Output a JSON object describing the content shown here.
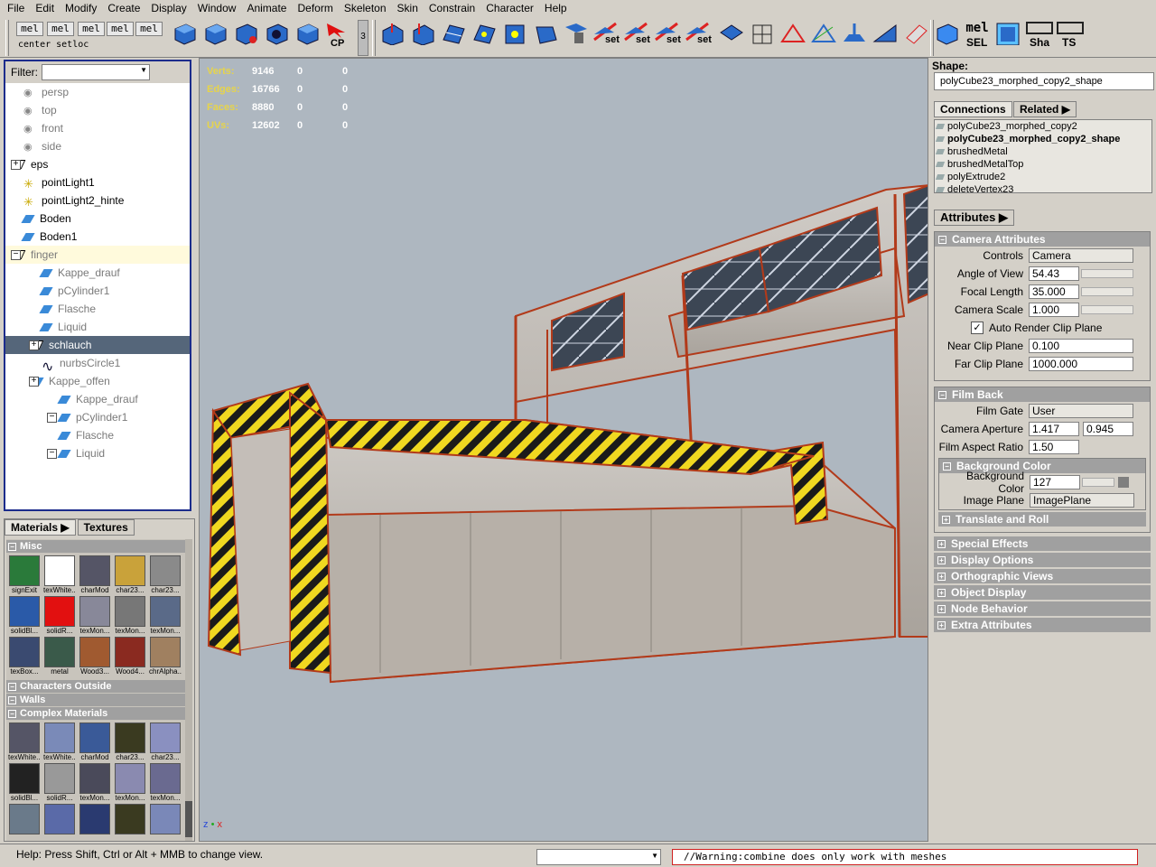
{
  "menubar": [
    "File",
    "Edit",
    "Modify",
    "Create",
    "Display",
    "Window",
    "Animate",
    "Deform",
    "Skeleton",
    "Skin",
    "Constrain",
    "Character",
    "Help"
  ],
  "toolbar": {
    "mel_labels": [
      "mel",
      "mel",
      "mel",
      "mel",
      "mel"
    ],
    "mel_caption": "center setloc",
    "cp_label": "CP",
    "shelf_num": "3",
    "set_labels": [
      "set",
      "set",
      "set",
      "set"
    ],
    "mel_right": "mel",
    "sel_label": "SEL",
    "sha_label": "Sha",
    "ts_label": "TS"
  },
  "outliner": {
    "filter_label": "Filter:",
    "filter_value": "",
    "items": [
      {
        "label": "persp",
        "grey": true,
        "icon": "camera-icon"
      },
      {
        "label": "top",
        "grey": true,
        "icon": "camera-icon"
      },
      {
        "label": "front",
        "grey": true,
        "icon": "camera-icon"
      },
      {
        "label": "side",
        "grey": true,
        "icon": "camera-icon"
      },
      {
        "label": "eps",
        "grey": false,
        "icon": "transform-icon"
      },
      {
        "label": "pointLight1",
        "grey": false,
        "icon": "light-icon"
      },
      {
        "label": "pointLight2_hinte",
        "grey": false,
        "icon": "light-icon"
      },
      {
        "label": "Boden",
        "grey": false,
        "icon": "mesh-icon"
      },
      {
        "label": "Boden1",
        "grey": false,
        "icon": "mesh-icon"
      },
      {
        "label": "finger",
        "grey": true,
        "icon": "transform-icon"
      },
      {
        "label": "Kappe_drauf",
        "grey": true,
        "icon": "mesh-icon"
      },
      {
        "label": "pCylinder1",
        "grey": true,
        "icon": "mesh-icon"
      },
      {
        "label": "Flasche",
        "grey": true,
        "icon": "mesh-icon"
      },
      {
        "label": "Liquid",
        "grey": true,
        "icon": "mesh-icon"
      },
      {
        "label": "schlauch",
        "grey": false,
        "icon": "transform-icon"
      },
      {
        "label": "nurbsCircle1",
        "grey": true,
        "icon": "curve-icon"
      },
      {
        "label": "Kappe_offen",
        "grey": true,
        "icon": "mesh-icon"
      },
      {
        "label": "Kappe_drauf",
        "grey": true,
        "icon": "mesh-icon"
      },
      {
        "label": "pCylinder1",
        "grey": true,
        "icon": "mesh-icon"
      },
      {
        "label": "Flasche",
        "grey": true,
        "icon": "mesh-icon"
      },
      {
        "label": "Liquid",
        "grey": true,
        "icon": "mesh-icon"
      }
    ]
  },
  "hud": [
    {
      "k": "Verts:",
      "v": "9146",
      "a": "0",
      "b": "0"
    },
    {
      "k": "Edges:",
      "v": "16766",
      "a": "0",
      "b": "0"
    },
    {
      "k": "Faces:",
      "v": "8880",
      "a": "0",
      "b": "0"
    },
    {
      "k": "UVs:",
      "v": "12602",
      "a": "0",
      "b": "0"
    }
  ],
  "axis": {
    "z": "z",
    "x": "x"
  },
  "hypershade": {
    "tab_materials": "Materials",
    "tab_textures": "Textures",
    "sections": {
      "misc": "Misc",
      "chars": "Characters Outside",
      "walls": "Walls",
      "complex": "Complex Materials"
    },
    "misc_swatches": [
      {
        "label": "signExit",
        "color": "#2a7a3a"
      },
      {
        "label": "texWhite...",
        "color": "#ffffff"
      },
      {
        "label": "charMod",
        "color": "#556"
      },
      {
        "label": "char23...",
        "color": "#c9a23a"
      },
      {
        "label": "char23...",
        "color": "#8a8a8a"
      },
      {
        "label": "solidBl...",
        "color": "#2a5aa8"
      },
      {
        "label": "solidR...",
        "color": "#e21010"
      },
      {
        "label": "texMon...",
        "color": "#889"
      },
      {
        "label": "texMon...",
        "color": "#777"
      },
      {
        "label": "texMon...",
        "color": "#5a6a88"
      },
      {
        "label": "texBox...",
        "color": "#3a4a70"
      },
      {
        "label": "metal",
        "color": "#3a5a4a"
      },
      {
        "label": "Wood3...",
        "color": "#a05a30"
      },
      {
        "label": "Wood4...",
        "color": "#8a2a20"
      },
      {
        "label": "chrAlpha...",
        "color": "#a08060"
      }
    ],
    "complex_swatches": [
      {
        "label": "texWhite...",
        "color": "#556"
      },
      {
        "label": "texWhite...",
        "color": "#7a8ab8"
      },
      {
        "label": "charMod",
        "color": "#3a5a98"
      },
      {
        "label": "char23...",
        "color": "#3a3a20"
      },
      {
        "label": "char23...",
        "color": "#8a90c0"
      },
      {
        "label": "solidBl...",
        "color": "#222"
      },
      {
        "label": "solidR...",
        "color": "#999"
      },
      {
        "label": "texMon...",
        "color": "#4a4a5a"
      },
      {
        "label": "texMon...",
        "color": "#8a8ab0"
      },
      {
        "label": "texMon...",
        "color": "#6a6a90"
      },
      {
        "label": "",
        "color": "#6a7a8a"
      },
      {
        "label": "",
        "color": "#5a6aa8"
      },
      {
        "label": "",
        "color": "#2a3a70"
      },
      {
        "label": "",
        "color": "#3a3a20"
      },
      {
        "label": "",
        "color": "#7a88b8"
      }
    ]
  },
  "attr": {
    "shape_label": "Shape:",
    "shape_name": "polyCube23_morphed_copy2_shape",
    "tab_connections": "Connections",
    "tab_related": "Related",
    "connections": [
      "polyCube23_morphed_copy2",
      "polyCube23_morphed_copy2_shape",
      "brushedMetal",
      "brushedMetalTop",
      "polyExtrude2",
      "deleteVertex23"
    ],
    "attributes_tab": "Attributes",
    "camera": {
      "title": "Camera Attributes",
      "controls_label": "Controls",
      "controls": "Camera",
      "aov_label": "Angle of View",
      "aov": "54.43",
      "fl_label": "Focal Length",
      "fl": "35.000",
      "cs_label": "Camera Scale",
      "cs": "1.000",
      "auto_label": "Auto Render Clip Plane",
      "near_label": "Near Clip Plane",
      "near": "0.100",
      "far_label": "Far Clip Plane",
      "far": "1000.000"
    },
    "film": {
      "title": "Film Back",
      "gate_label": "Film Gate",
      "gate": "User",
      "aperture_label": "Camera Aperture",
      "ap1": "1.417",
      "ap2": "0.945",
      "ratio_label": "Film Aspect Ratio",
      "ratio": "1.50"
    },
    "bg": {
      "title": "Background Color",
      "bg_label": "Background Color",
      "bg": "127",
      "ip_label": "Image Plane",
      "ip": "ImagePlane"
    },
    "sections": [
      "Translate and Roll",
      "Special Effects",
      "Display Options",
      "Orthographic Views",
      "Object Display",
      "Node Behavior",
      "Extra Attributes"
    ]
  },
  "status": {
    "help": "Help: Press Shift, Ctrl or Alt + MMB to change view.",
    "warning": "//Warning:combine does only work with meshes"
  }
}
